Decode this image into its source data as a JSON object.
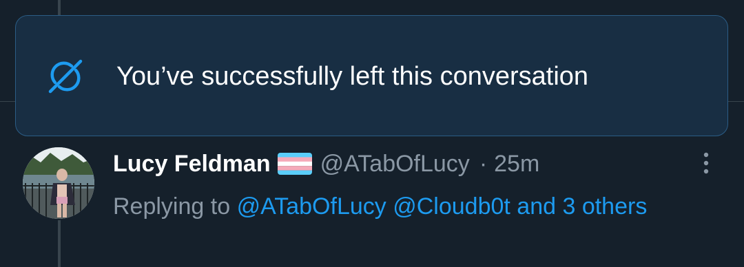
{
  "toast": {
    "message": "You’ve successfully left this conversation",
    "icon": "unfollow-conversation-icon",
    "accent_color": "#1d9bf0"
  },
  "tweet": {
    "display_name": "Lucy Feldman",
    "flag_icon": "transgender-flag-icon",
    "handle": "@ATabOfLucy",
    "separator": "·",
    "timestamp": "25m",
    "reply_prefix": "Replying to",
    "mentions": [
      "@ATabOfLucy",
      "@Cloudb0t"
    ],
    "others_text": "and 3 others",
    "more_icon": "more-options-icon"
  },
  "colors": {
    "background": "#15202b",
    "toast_background": "#182e43",
    "toast_border": "#2b5d86",
    "link": "#1d9bf0",
    "secondary_text": "#8b98a5"
  }
}
